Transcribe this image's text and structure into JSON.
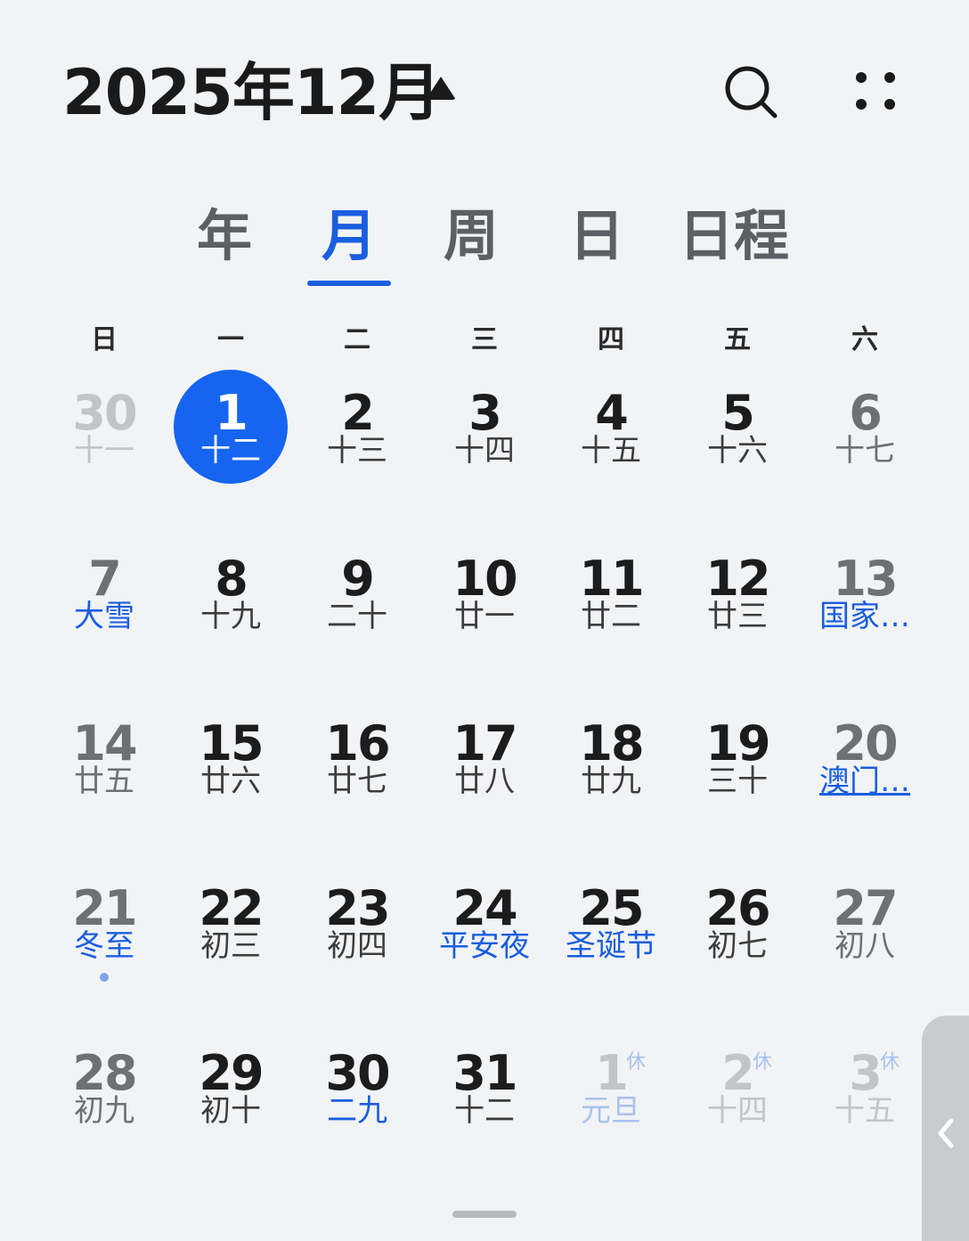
{
  "header": {
    "title": "2025年12月"
  },
  "tabs": [
    "年",
    "月",
    "周",
    "日",
    "日程"
  ],
  "weekdays": [
    "日",
    "一",
    "二",
    "三",
    "四",
    "五",
    "六"
  ],
  "rows": [
    [
      {
        "num": "30",
        "sub": "十一"
      },
      {
        "num": "1",
        "sub": "十二"
      },
      {
        "num": "2",
        "sub": "十三"
      },
      {
        "num": "3",
        "sub": "十四"
      },
      {
        "num": "4",
        "sub": "十五"
      },
      {
        "num": "5",
        "sub": "十六"
      },
      {
        "num": "6",
        "sub": "十七"
      }
    ],
    [
      {
        "num": "7",
        "sub": "大雪"
      },
      {
        "num": "8",
        "sub": "十九"
      },
      {
        "num": "9",
        "sub": "二十"
      },
      {
        "num": "10",
        "sub": "廿一"
      },
      {
        "num": "11",
        "sub": "廿二"
      },
      {
        "num": "12",
        "sub": "廿三"
      },
      {
        "num": "13",
        "sub": "国家…"
      }
    ],
    [
      {
        "num": "14",
        "sub": "廿五"
      },
      {
        "num": "15",
        "sub": "廿六"
      },
      {
        "num": "16",
        "sub": "廿七"
      },
      {
        "num": "17",
        "sub": "廿八"
      },
      {
        "num": "18",
        "sub": "廿九"
      },
      {
        "num": "19",
        "sub": "三十"
      },
      {
        "num": "20",
        "sub": "澳门…"
      }
    ],
    [
      {
        "num": "21",
        "sub": "冬至"
      },
      {
        "num": "22",
        "sub": "初三"
      },
      {
        "num": "23",
        "sub": "初四"
      },
      {
        "num": "24",
        "sub": "平安夜"
      },
      {
        "num": "25",
        "sub": "圣诞节"
      },
      {
        "num": "26",
        "sub": "初七"
      },
      {
        "num": "27",
        "sub": "初八"
      }
    ],
    [
      {
        "num": "28",
        "sub": "初九"
      },
      {
        "num": "29",
        "sub": "初十"
      },
      {
        "num": "30",
        "sub": "二九"
      },
      {
        "num": "31",
        "sub": "十二"
      },
      {
        "num": "1",
        "sub": "元旦",
        "tag": "休"
      },
      {
        "num": "2",
        "sub": "十四",
        "tag": "休"
      },
      {
        "num": "3",
        "sub": "十五",
        "tag": "休"
      }
    ]
  ],
  "colors": {
    "accent": "#1a5ee0",
    "today": "#1665f0",
    "background": "#f1f3f5"
  }
}
